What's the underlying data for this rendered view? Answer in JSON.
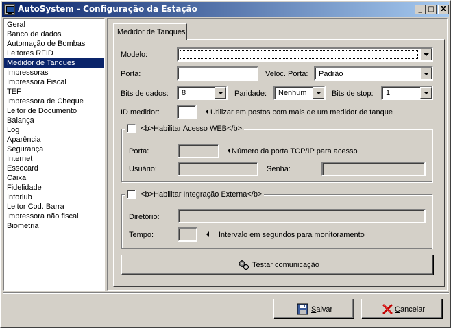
{
  "window": {
    "title": "AutoSystem - Configuração da Estação",
    "minimize": "_",
    "maximize": "□",
    "close": "X"
  },
  "sidebar": {
    "items": [
      {
        "label": "Geral"
      },
      {
        "label": "Banco de dados"
      },
      {
        "label": "Automação de Bombas"
      },
      {
        "label": "Leitores RFID"
      },
      {
        "label": "Medidor de Tanques",
        "selected": true
      },
      {
        "label": "Impressoras"
      },
      {
        "label": "Impressora Fiscal"
      },
      {
        "label": "TEF"
      },
      {
        "label": "Impressora de Cheque"
      },
      {
        "label": "Leitor de Documento"
      },
      {
        "label": "Balança"
      },
      {
        "label": "Log"
      },
      {
        "label": "Aparência"
      },
      {
        "label": "Segurança"
      },
      {
        "label": "Internet"
      },
      {
        "label": "Essocard"
      },
      {
        "label": "Caixa"
      },
      {
        "label": "Fidelidade"
      },
      {
        "label": "Inforlub"
      },
      {
        "label": "Leitor Cod. Barra"
      },
      {
        "label": "Impressora não fiscal"
      },
      {
        "label": "Biometria"
      }
    ]
  },
  "tab": {
    "label": "Medidor de Tanques"
  },
  "form": {
    "modelo_label": "Modelo:",
    "modelo_value": "",
    "porta_label": "Porta:",
    "porta_value": "",
    "veloc_label": "Veloc. Porta:",
    "veloc_value": "Padrão",
    "bits_dados_label": "Bits de dados:",
    "bits_dados_value": "8",
    "paridade_label": "Paridade:",
    "paridade_value": "Nenhum",
    "bits_stop_label": "Bits de stop:",
    "bits_stop_value": "1",
    "id_medidor_label": "ID medidor:",
    "id_medidor_value": "",
    "id_medidor_hint": "Utilizar em postos com mais de um medidor de tanque"
  },
  "web": {
    "checkbox_label": "<b>Habilitar Acesso WEB</b>",
    "checked": false,
    "porta_label": "Porta:",
    "porta_hint": "Número da porta TCP/IP para acesso",
    "usuario_label": "Usuário:",
    "senha_label": "Senha:"
  },
  "integracao": {
    "checkbox_label": "<b>Habilitar Integração Externa</b>",
    "checked": false,
    "diretorio_label": "Diretório:",
    "tempo_label": "Tempo:",
    "tempo_hint": "Intervalo em segundos para monitoramento"
  },
  "buttons": {
    "testar": "Testar comunicação",
    "salvar_prefix": "",
    "salvar_mnemonic": "S",
    "salvar_rest": "alvar",
    "cancelar_mnemonic": "C",
    "cancelar_rest": "ancelar"
  },
  "colors": {
    "title_start": "#0a246a",
    "title_end": "#a6caf0",
    "selection": "#0a246a",
    "face": "#d4d0c8"
  },
  "icons": [
    "app-icon",
    "gears-icon",
    "floppy-disk-icon",
    "red-x-icon",
    "dropdown-arrow-icon",
    "left-arrow-hint-icon"
  ]
}
